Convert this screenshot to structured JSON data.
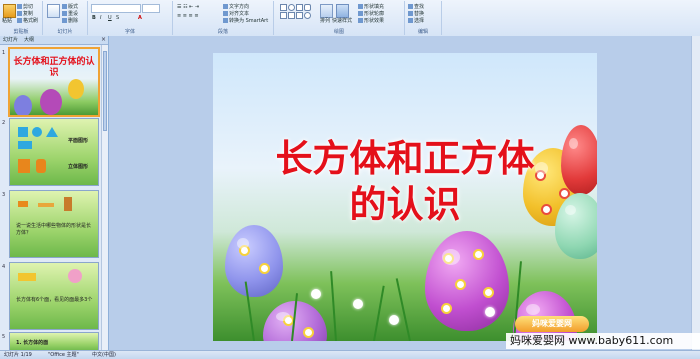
{
  "ribbon": {
    "groups": [
      {
        "label": "剪贴板"
      },
      {
        "label": "幻灯片"
      },
      {
        "label": "字体"
      },
      {
        "label": "段落"
      },
      {
        "label": "绘图"
      },
      {
        "label": "编辑"
      }
    ],
    "clipboard": {
      "paste": "粘贴",
      "cut": "剪切",
      "copy": "复制",
      "format_painter": "格式刷"
    },
    "slides": {
      "new_slide": "新建\n幻灯片",
      "layout": "版式",
      "reset": "重设",
      "delete": "删除"
    },
    "paragraph": {
      "text_direction": "文字方向",
      "align_text": "对齐文本",
      "smartart": "转换为 SmartArt"
    },
    "drawing": {
      "arrange": "排列",
      "quick_styles": "快速样式",
      "shape_fill": "形状填充",
      "shape_outline": "形状轮廓",
      "shape_effects": "形状效果"
    },
    "editing": {
      "find": "查找",
      "replace": "替换",
      "select": "选择"
    }
  },
  "left_panel": {
    "tabs": [
      "幻灯片",
      "大纲"
    ],
    "close": "×",
    "slides": [
      {
        "num": "1",
        "title": "长方体和正方体的认识"
      },
      {
        "num": "2",
        "labels": [
          "平面图形",
          "立体图形"
        ]
      },
      {
        "num": "3",
        "text": "说一说生活中哪些物体的形状是长方体？"
      },
      {
        "num": "4",
        "text": "长方体有6个面，看见的面最多3个"
      },
      {
        "num": "5",
        "text": "1. 长方体的面"
      }
    ]
  },
  "slide": {
    "title_line1": "长方体和正方体",
    "title_line2": "的认识",
    "logo_text": "妈咪爱婴网"
  },
  "watermark": "妈咪爱婴网 www.baby611.com",
  "status": {
    "slide_count": "幻灯片 1/19",
    "theme": "\"Office 主题\"",
    "language": "中文(中国)"
  },
  "colors": {
    "title_red": "#e4101a",
    "ribbon_bg": "#d6e4f6",
    "selection_orange": "#f0a335"
  }
}
